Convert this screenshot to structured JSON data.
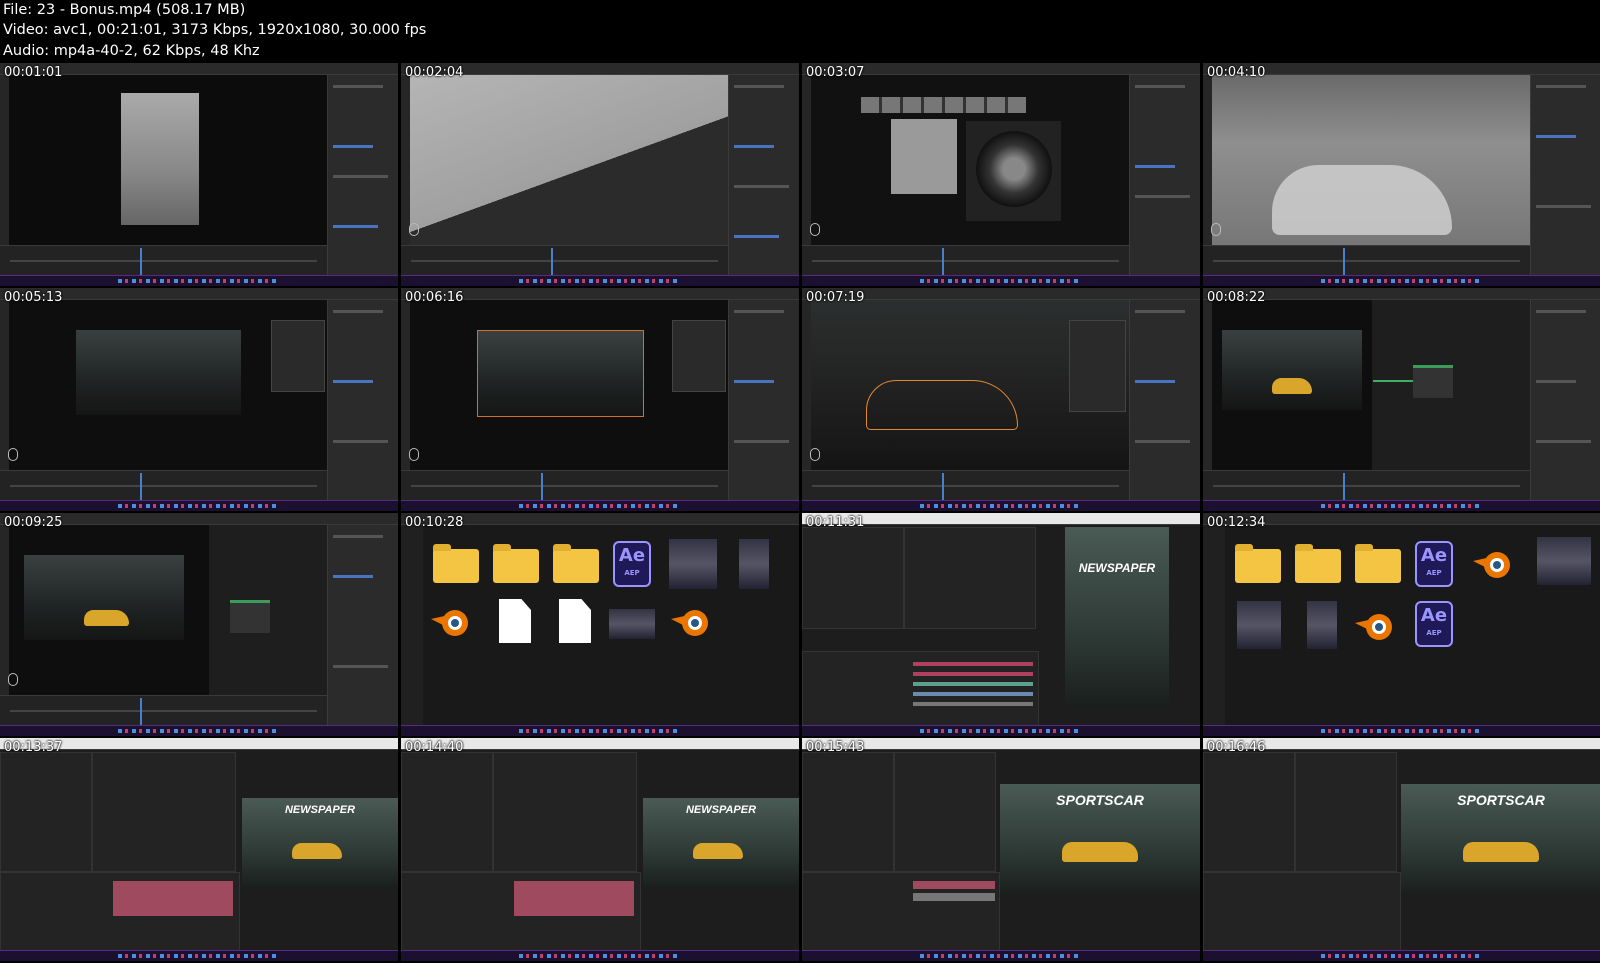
{
  "header": {
    "file_line": "File: 23 - Bonus.mp4 (508.17 MB)",
    "video_line": "Video: avc1, 00:21:01, 3173 Kbps, 1920x1080, 30.000 fps",
    "audio_line": "Audio: mp4a-40-2, 62 Kbps, 48 Khz"
  },
  "frames": [
    {
      "timestamp": "00:01:01"
    },
    {
      "timestamp": "00:02:04"
    },
    {
      "timestamp": "00:03:07"
    },
    {
      "timestamp": "00:04:10"
    },
    {
      "timestamp": "00:05:13"
    },
    {
      "timestamp": "00:06:16"
    },
    {
      "timestamp": "00:07:19"
    },
    {
      "timestamp": "00:08:22"
    },
    {
      "timestamp": "00:09:25"
    },
    {
      "timestamp": "00:10:28"
    },
    {
      "timestamp": "00:11:31"
    },
    {
      "timestamp": "00:12:34"
    },
    {
      "timestamp": "00:13:37"
    },
    {
      "timestamp": "00:14:40"
    },
    {
      "timestamp": "00:15:43"
    },
    {
      "timestamp": "00:16:46"
    }
  ],
  "posters": {
    "newspaper": "NEWSPAPER",
    "sportscar": "SPORTSCAR"
  },
  "icons": {
    "ae_big": "Ae",
    "ae_small": "AEP"
  },
  "colors": {
    "folder": "#f4c542",
    "ae_purple": "#9b95ff",
    "blender_orange": "#ea7600",
    "taskbar": "#1b1030",
    "car_yellow": "#d9a52a"
  }
}
